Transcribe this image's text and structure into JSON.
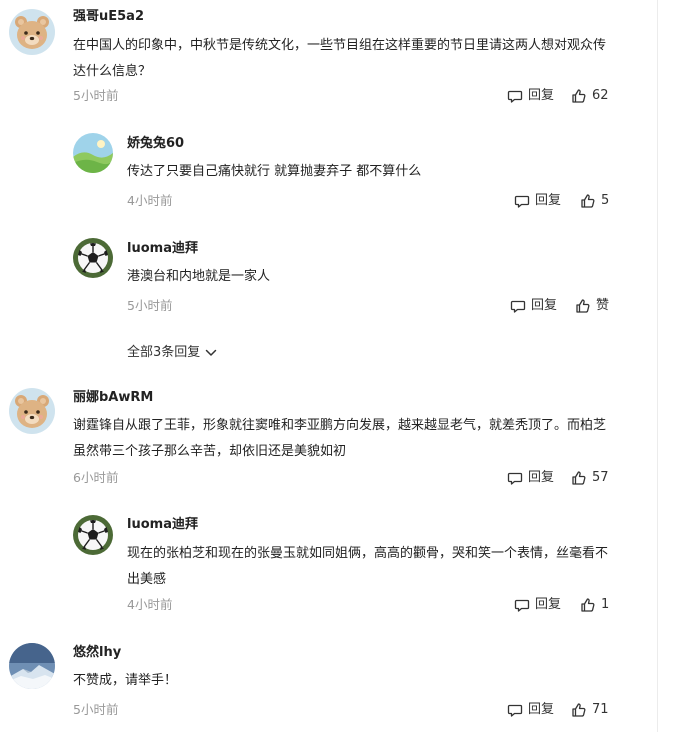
{
  "comments": [
    {
      "user": "强哥uE5a2",
      "text": "在中国人的印象中，中秋节是传统文化，一些节目组在这样重要的节日里请这两人想对观众传达什么信息？",
      "time": "5小时前",
      "reply": "回复",
      "likes": "62",
      "avatar": "bear-avatar"
    },
    {
      "user": "娇兔兔60",
      "text": "传达了只要自己痛快就行 就算抛妻弃子 都不算什么",
      "time": "4小时前",
      "reply": "回复",
      "likes": "5",
      "avatar": "landscape-avatar"
    },
    {
      "user": "luoma迪拜",
      "text": "港澳台和内地就是一家人",
      "time": "5小时前",
      "reply": "回复",
      "likes": "赞",
      "avatar": "soccer-ball-avatar"
    },
    {
      "user": "丽娜bAwRM",
      "text": "谢霆锋自从跟了王菲，形象就往窦唯和李亚鹏方向发展，越来越显老气，就差秃顶了。而柏芝虽然带三个孩子那么辛苦，却依旧还是美貌如初",
      "time": "6小时前",
      "reply": "回复",
      "likes": "57",
      "avatar": "bear-avatar"
    },
    {
      "user": "luoma迪拜",
      "text": "现在的张柏芝和现在的张曼玉就如同姐俩，高高的颧骨，哭和笑一个表情，丝毫看不出美感",
      "time": "4小时前",
      "reply": "回复",
      "likes": "1",
      "avatar": "soccer-ball-avatar"
    },
    {
      "user": "悠然lhy",
      "text": "不赞成，请举手！",
      "time": "5小时前",
      "reply": "回复",
      "likes": "71",
      "avatar": "mountain-avatar"
    }
  ],
  "expand_replies": "全部3条回复",
  "colors": {
    "text": "#222222",
    "meta": "#999999",
    "action": "#333333"
  }
}
